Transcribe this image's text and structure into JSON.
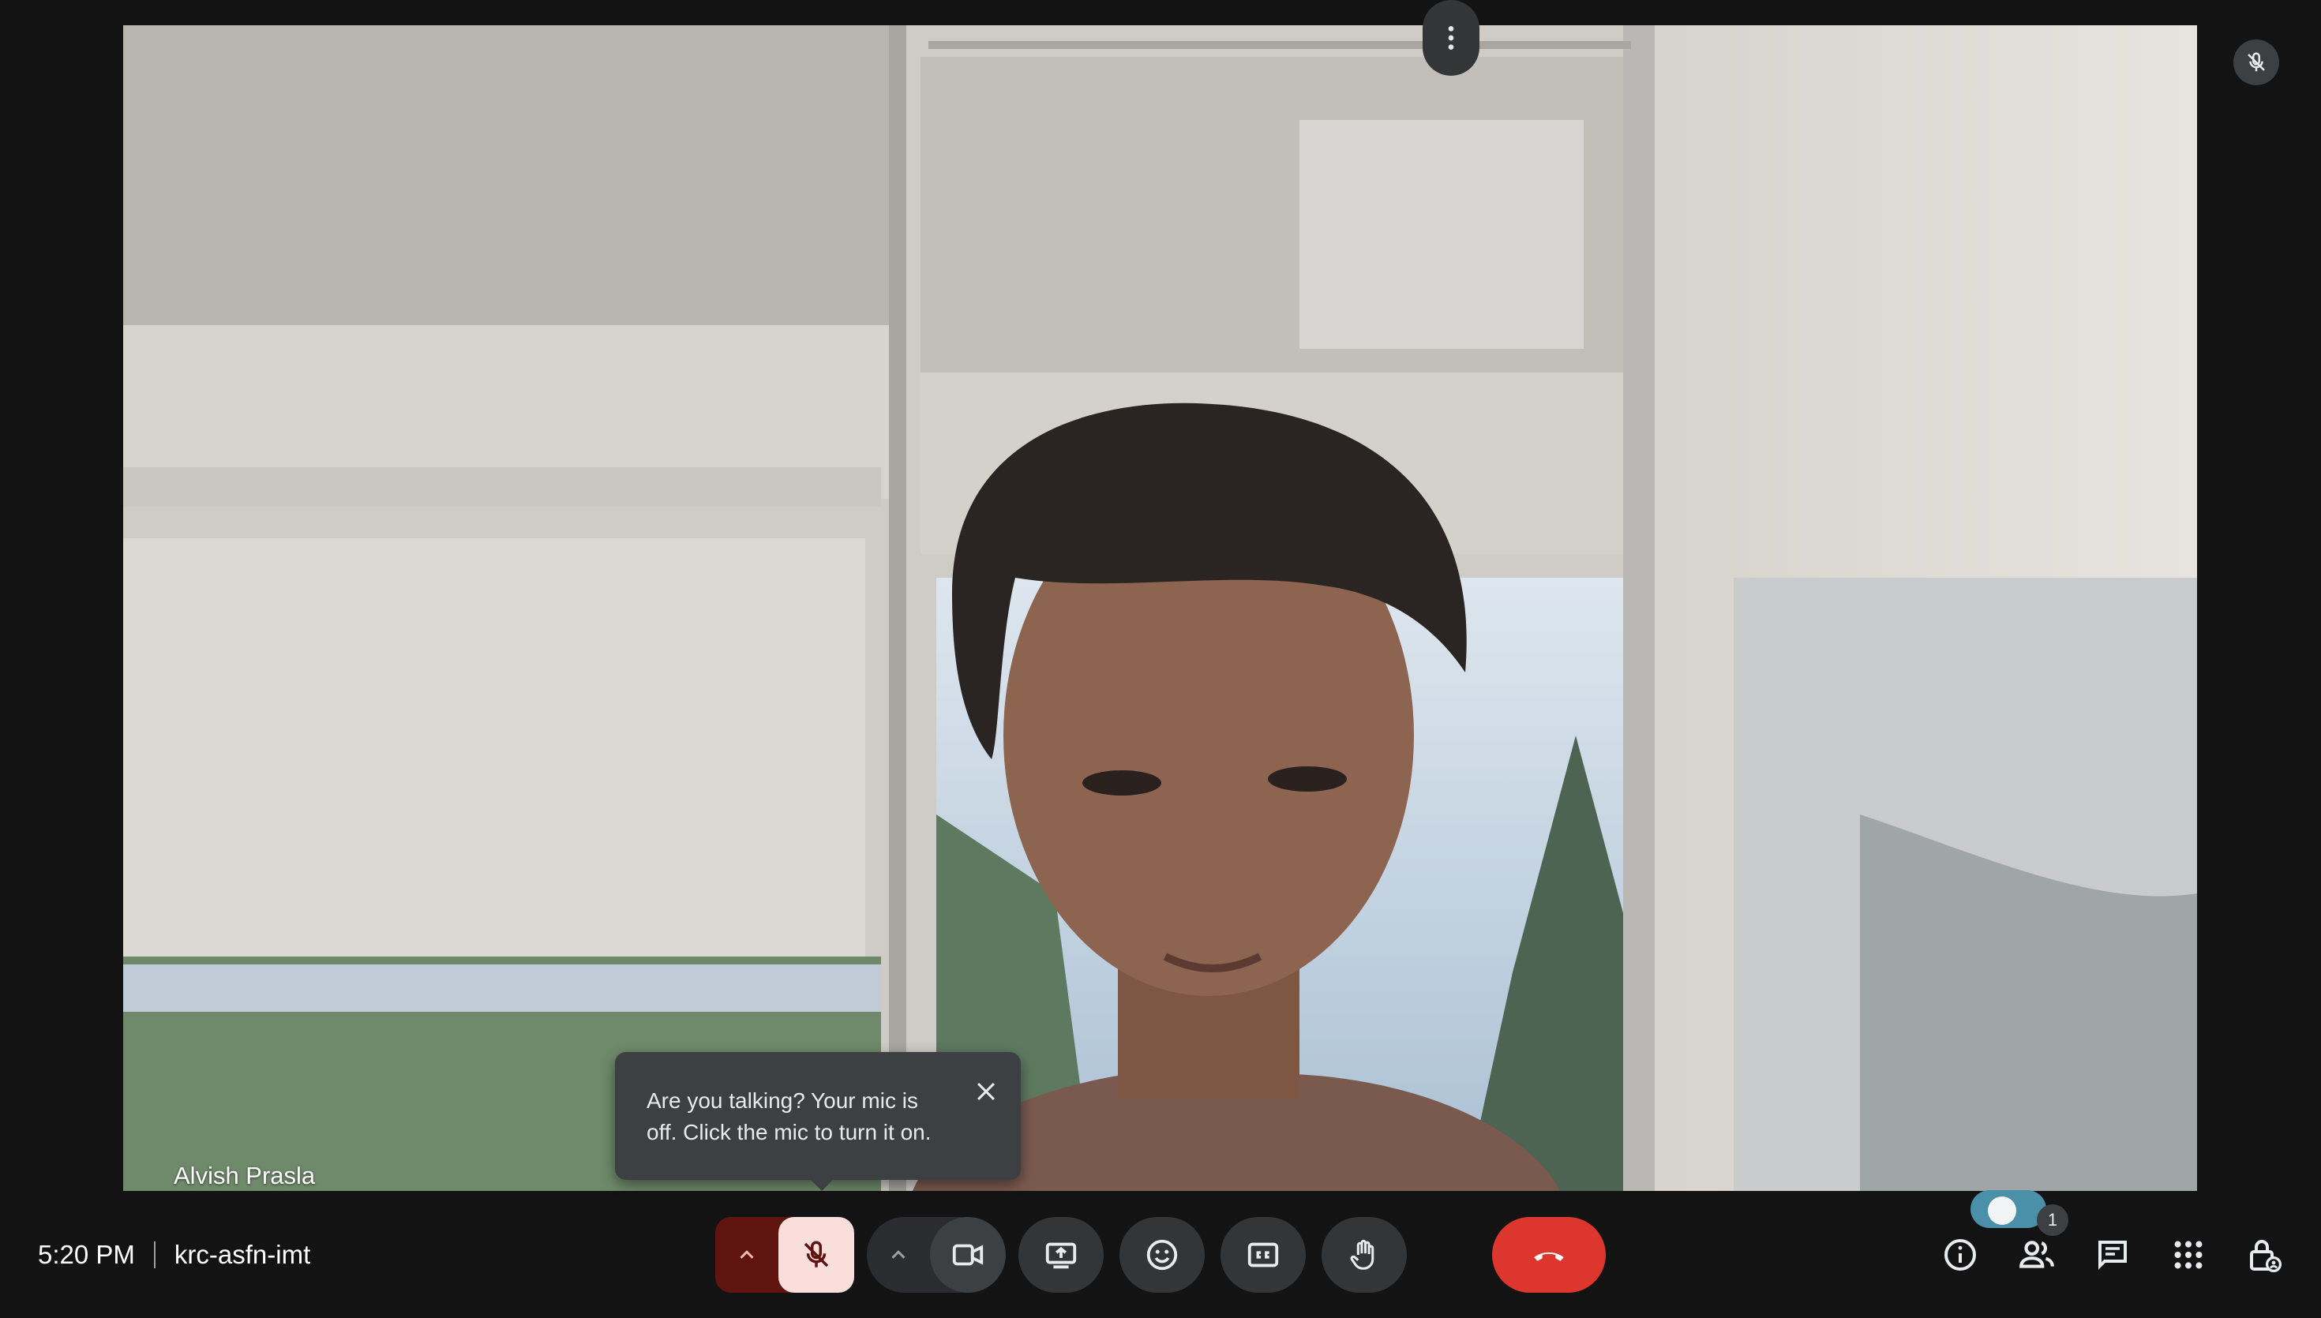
{
  "participant": {
    "name": "Alvish Prasla"
  },
  "tooltip": {
    "message": "Are you talking? Your mic is off. Click the mic to turn it on."
  },
  "meeting": {
    "time": "5:20 PM",
    "code": "krc-asfn-imt"
  },
  "controls": {
    "mic": {
      "state": "off",
      "icon": "mic-off-icon",
      "options_icon": "chevron-up-icon"
    },
    "camera": {
      "state": "on",
      "icon": "videocam-icon",
      "options_icon": "chevron-up-icon"
    },
    "present": {
      "icon": "present-screen-icon"
    },
    "reactions": {
      "icon": "emoji-icon"
    },
    "captions": {
      "icon": "closed-captions-icon"
    },
    "raise_hand": {
      "icon": "hand-icon"
    },
    "more": {
      "icon": "more-vert-icon"
    },
    "end_call": {
      "icon": "call-end-icon"
    }
  },
  "side_controls": {
    "people_count": "1",
    "toggle_on": true,
    "icons": [
      "info-icon",
      "people-icon",
      "chat-icon",
      "activities-icon",
      "host-controls-icon"
    ]
  },
  "colors": {
    "background": "#131313",
    "button": "#333537",
    "mic_off_bg": "#f9dedc",
    "mic_off_dark": "#601410",
    "end_call": "#dc362e",
    "tooltip": "#3c4043"
  }
}
